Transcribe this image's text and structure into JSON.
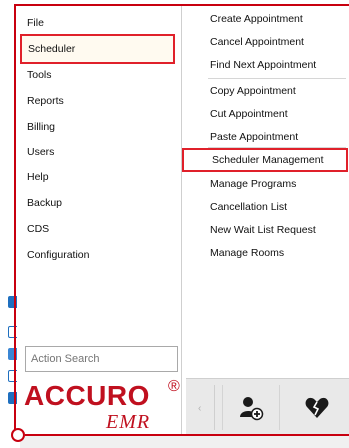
{
  "left_menu": {
    "items": [
      {
        "label": "File"
      },
      {
        "label": "Scheduler"
      },
      {
        "label": "Tools"
      },
      {
        "label": "Reports"
      },
      {
        "label": "Billing"
      },
      {
        "label": "Users"
      },
      {
        "label": "Help"
      },
      {
        "label": "Backup"
      },
      {
        "label": "CDS"
      },
      {
        "label": "Configuration"
      }
    ],
    "selected": "Scheduler"
  },
  "submenu": {
    "groups": [
      [
        "Create Appointment",
        "Cancel Appointment",
        "Find Next Appointment"
      ],
      [
        "Copy Appointment",
        "Cut Appointment",
        "Paste Appointment"
      ],
      [
        "Scheduler Management",
        "Manage Programs",
        "Cancellation List",
        "New Wait List Request",
        "Manage Rooms"
      ]
    ],
    "highlighted": "Scheduler Management"
  },
  "search": {
    "placeholder": "Action Search"
  },
  "logo": {
    "main": "ACCURO",
    "reg": "®",
    "sub": "EMR"
  },
  "bottom_panel": {
    "buttons": [
      {
        "icon": "add-user-icon"
      },
      {
        "icon": "broken-heart-icon"
      }
    ]
  },
  "colors": {
    "accent": "#c8000f",
    "highlight_border": "#e0202a",
    "logo": "#c0101f"
  }
}
